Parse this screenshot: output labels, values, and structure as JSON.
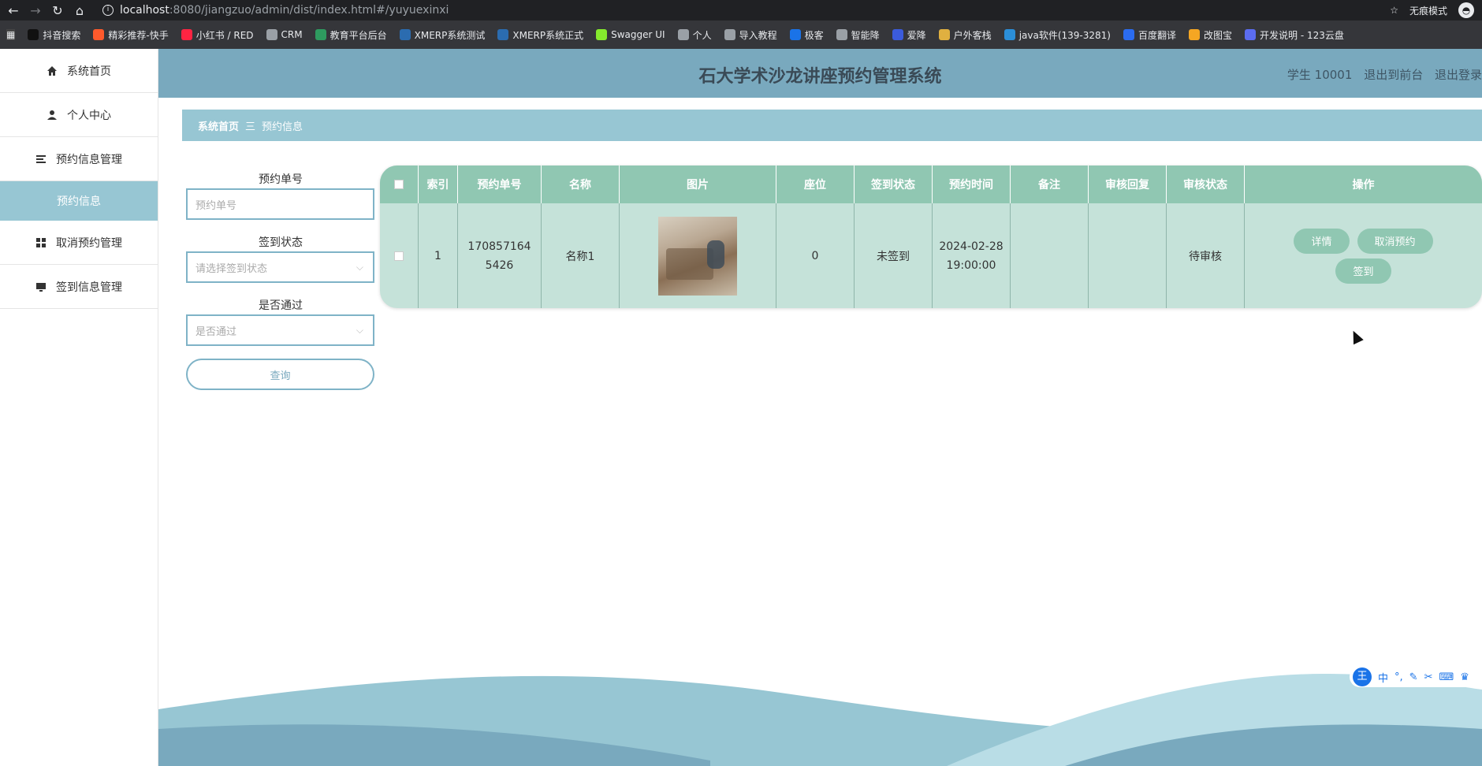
{
  "browser": {
    "url_host": "localhost",
    "url_path": ":8080/jiangzuo/admin/dist/index.html#/yuyuexinxi",
    "incognito_label": "无痕模式",
    "bookmarks": [
      {
        "label": "抖音搜索",
        "color": "#111111"
      },
      {
        "label": "精彩推荐-快手",
        "color": "#ff5a2c"
      },
      {
        "label": "小红书 / RED",
        "color": "#ff2442"
      },
      {
        "label": "CRM",
        "color": "#9aa0a6"
      },
      {
        "label": "教育平台后台",
        "color": "#2e9b5f"
      },
      {
        "label": "XMERP系统测试",
        "color": "#2b6cb0"
      },
      {
        "label": "XMERP系统正式",
        "color": "#2b6cb0"
      },
      {
        "label": "Swagger UI",
        "color": "#85ea2d"
      },
      {
        "label": "个人",
        "color": "#9aa0a6"
      },
      {
        "label": "导入教程",
        "color": "#9aa0a6"
      },
      {
        "label": "极客",
        "color": "#1a73e8"
      },
      {
        "label": "智能降",
        "color": "#9aa0a6"
      },
      {
        "label": "爱降",
        "color": "#3b5bdb"
      },
      {
        "label": "户外客栈",
        "color": "#e0b040"
      },
      {
        "label": "java软件(139-3281)",
        "color": "#2b8fd9"
      },
      {
        "label": "百度翻译",
        "color": "#2b6cf0"
      },
      {
        "label": "改图宝",
        "color": "#f5a623"
      },
      {
        "label": "开发说明 - 123云盘",
        "color": "#5b6cf0"
      }
    ]
  },
  "sidebar": {
    "items": [
      {
        "label": "系统首页",
        "icon": "home-icon"
      },
      {
        "label": "个人中心",
        "icon": "user-icon"
      },
      {
        "label": "预约信息管理",
        "icon": "list-icon"
      },
      {
        "label": "预约信息",
        "icon": ""
      },
      {
        "label": "取消预约管理",
        "icon": "grid-icon"
      },
      {
        "label": "签到信息管理",
        "icon": "monitor-icon"
      }
    ]
  },
  "header": {
    "title": "石大学术沙龙讲座预约管理系统",
    "user": "学生 10001",
    "to_front": "退出到前台",
    "logout": "退出登录"
  },
  "breadcrumb": {
    "home": "系统首页",
    "separator": "三",
    "current": "预约信息"
  },
  "search": {
    "order_no_label": "预约单号",
    "order_no_placeholder": "预约单号",
    "checkin_label": "签到状态",
    "checkin_placeholder": "请选择签到状态",
    "pass_label": "是否通过",
    "pass_placeholder": "是否通过",
    "query_button": "查询"
  },
  "table": {
    "headers": [
      "索引",
      "预约单号",
      "名称",
      "图片",
      "座位",
      "签到状态",
      "预约时间",
      "备注",
      "审核回复",
      "审核状态",
      "操作"
    ],
    "rows": [
      {
        "index": "1",
        "order_no": "1708571645426",
        "name": "名称1",
        "seat": "0",
        "checkin": "未签到",
        "time": "2024-02-28 19:00:00",
        "remark": "",
        "reply": "",
        "status": "待审核",
        "actions": {
          "detail": "详情",
          "cancel": "取消预约",
          "checkin": "签到"
        }
      }
    ]
  },
  "ime": {
    "lang": "中",
    "logo": "王"
  },
  "colors": {
    "header": "#79a9be",
    "breadcrumb": "#97c6d3",
    "table_head": "#90c7b2",
    "table_body": "#c5e2d9"
  }
}
